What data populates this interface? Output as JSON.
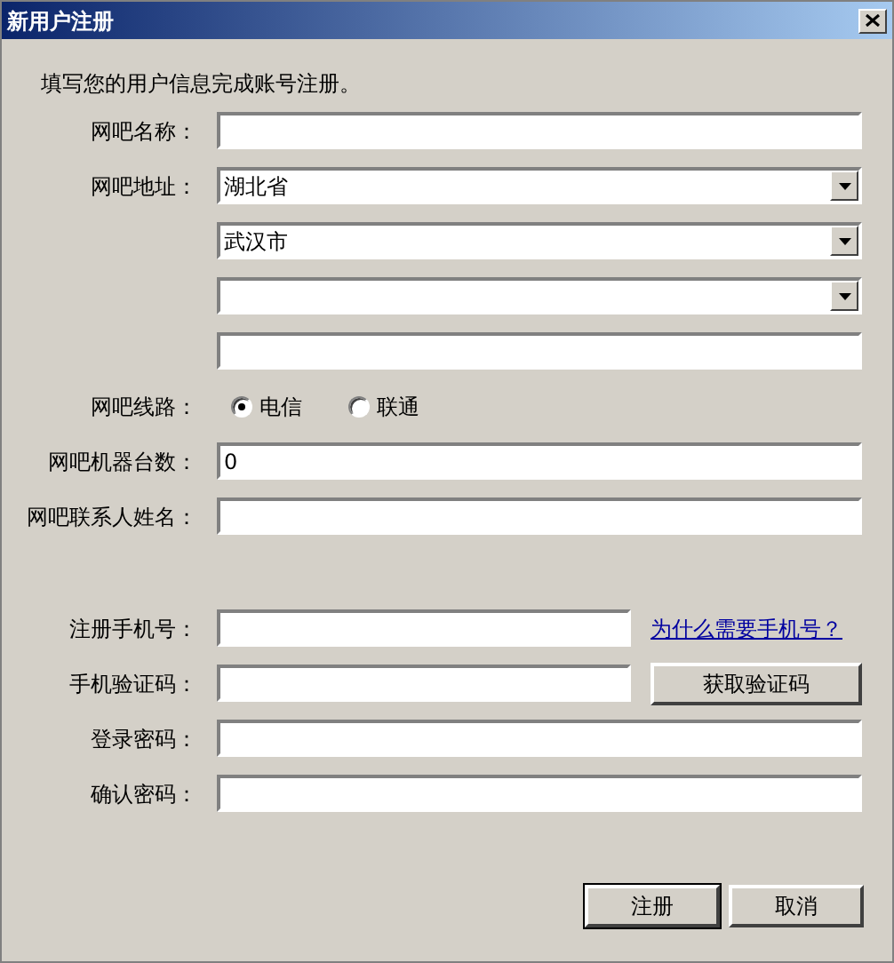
{
  "window": {
    "title": "新用户注册"
  },
  "intro": "填写您的用户信息完成账号注册。",
  "rows": [
    {
      "kind": "text",
      "label": "网吧名称："
    },
    {
      "kind": "select",
      "label": "网吧地址：",
      "value": "湖北省"
    },
    {
      "kind": "select",
      "value": "武汉市"
    },
    {
      "kind": "select"
    },
    {
      "kind": "text"
    },
    {
      "kind": "radio",
      "label": "网吧线路：",
      "options": [
        {
          "label": "电信",
          "selected": true
        },
        {
          "label": "联通",
          "selected": false
        }
      ]
    },
    {
      "kind": "text",
      "label": "网吧机器台数：",
      "value": "0"
    },
    {
      "kind": "text",
      "label": "网吧联系人姓名："
    },
    {
      "kind": "spacer"
    },
    {
      "kind": "text",
      "label": "注册手机号：",
      "link": "为什么需要手机号？"
    },
    {
      "kind": "text",
      "label": "手机验证码：",
      "button": "获取验证码"
    },
    {
      "kind": "text",
      "label": "登录密码："
    },
    {
      "kind": "text",
      "label": "确认密码："
    }
  ],
  "buttons": [
    {
      "label": "注册",
      "default": true
    },
    {
      "label": "取消",
      "default": false
    }
  ]
}
